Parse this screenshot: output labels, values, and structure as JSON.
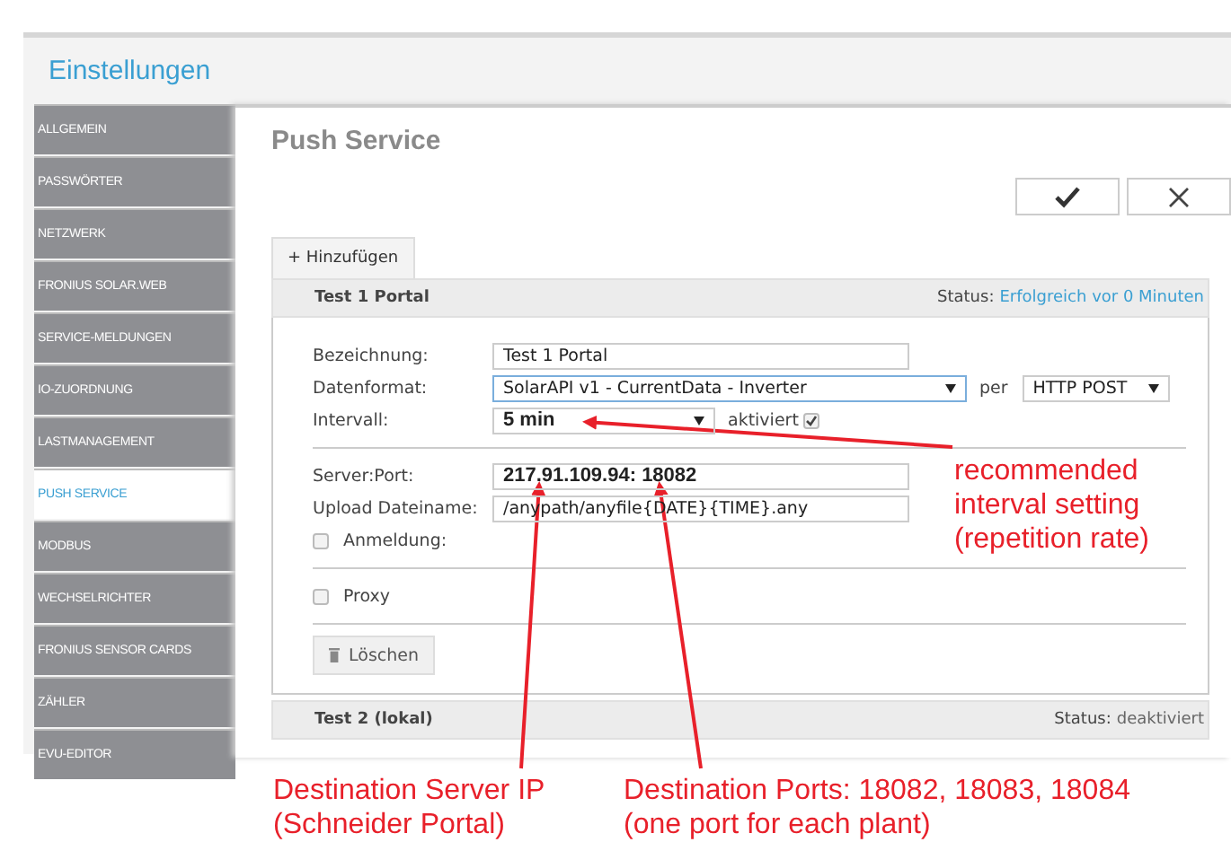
{
  "window": {
    "title": "Einstellungen"
  },
  "sidebar": {
    "items": [
      {
        "label": "ALLGEMEIN",
        "selected": false
      },
      {
        "label": "PASSWÖRTER",
        "selected": false
      },
      {
        "label": "NETZWERK",
        "selected": false
      },
      {
        "label": "FRONIUS SOLAR.WEB",
        "selected": false
      },
      {
        "label": "SERVICE-MELDUNGEN",
        "selected": false
      },
      {
        "label": "IO-ZUORDNUNG",
        "selected": false
      },
      {
        "label": "LASTMANAGEMENT",
        "selected": false
      },
      {
        "label": "PUSH SERVICE",
        "selected": true
      },
      {
        "label": "MODBUS",
        "selected": false
      },
      {
        "label": "WECHSELRICHTER",
        "selected": false
      },
      {
        "label": "FRONIUS SENSOR CARDS",
        "selected": false
      },
      {
        "label": "ZÄHLER",
        "selected": false
      },
      {
        "label": "EVU-EDITOR",
        "selected": false
      }
    ]
  },
  "page": {
    "title": "Push Service",
    "buttons": [
      {
        "kind": "confirm"
      },
      {
        "kind": "cancel"
      }
    ],
    "add_button": "+ Hinzufügen"
  },
  "entries": [
    {
      "name": "Test 1 Portal",
      "status_label": "Status:",
      "status": "Erfolgreich vor 0 Minuten",
      "ok": true,
      "expanded": true
    },
    {
      "name": "Test 2 (lokal)",
      "status_label": "Status:",
      "status": "deaktiviert",
      "ok": false,
      "expanded": false
    }
  ],
  "form": {
    "bezeichnung": {
      "label": "Bezeichnung:",
      "value": "Test 1 Portal"
    },
    "datenformat": {
      "label": "Datenformat:",
      "value": "SolarAPI v1 - CurrentData - Inverter",
      "per_label": "per",
      "method": "HTTP POST"
    },
    "intervall": {
      "label": "Intervall:",
      "value": "5 min",
      "activated_label": "aktiviert",
      "activated": true
    },
    "server_port": {
      "label": "Server:Port:",
      "value": "217.91.109.94: 18082"
    },
    "upload": {
      "label": "Upload Dateiname:",
      "value": "/anypath/anyfile{DATE}{TIME}.any"
    },
    "login": {
      "label": "Anmeldung:",
      "checked": false
    },
    "proxy": {
      "label": "Proxy",
      "checked": false
    },
    "delete_button": "Löschen"
  },
  "annotations": [
    {
      "text": "recommended\ninterval setting\n(repetition rate)"
    },
    {
      "text": "Destination Server IP\n(Schneider Portal)"
    },
    {
      "text": "Destination Ports: 18082, 18083, 18084\n(one port for each plant)"
    }
  ]
}
